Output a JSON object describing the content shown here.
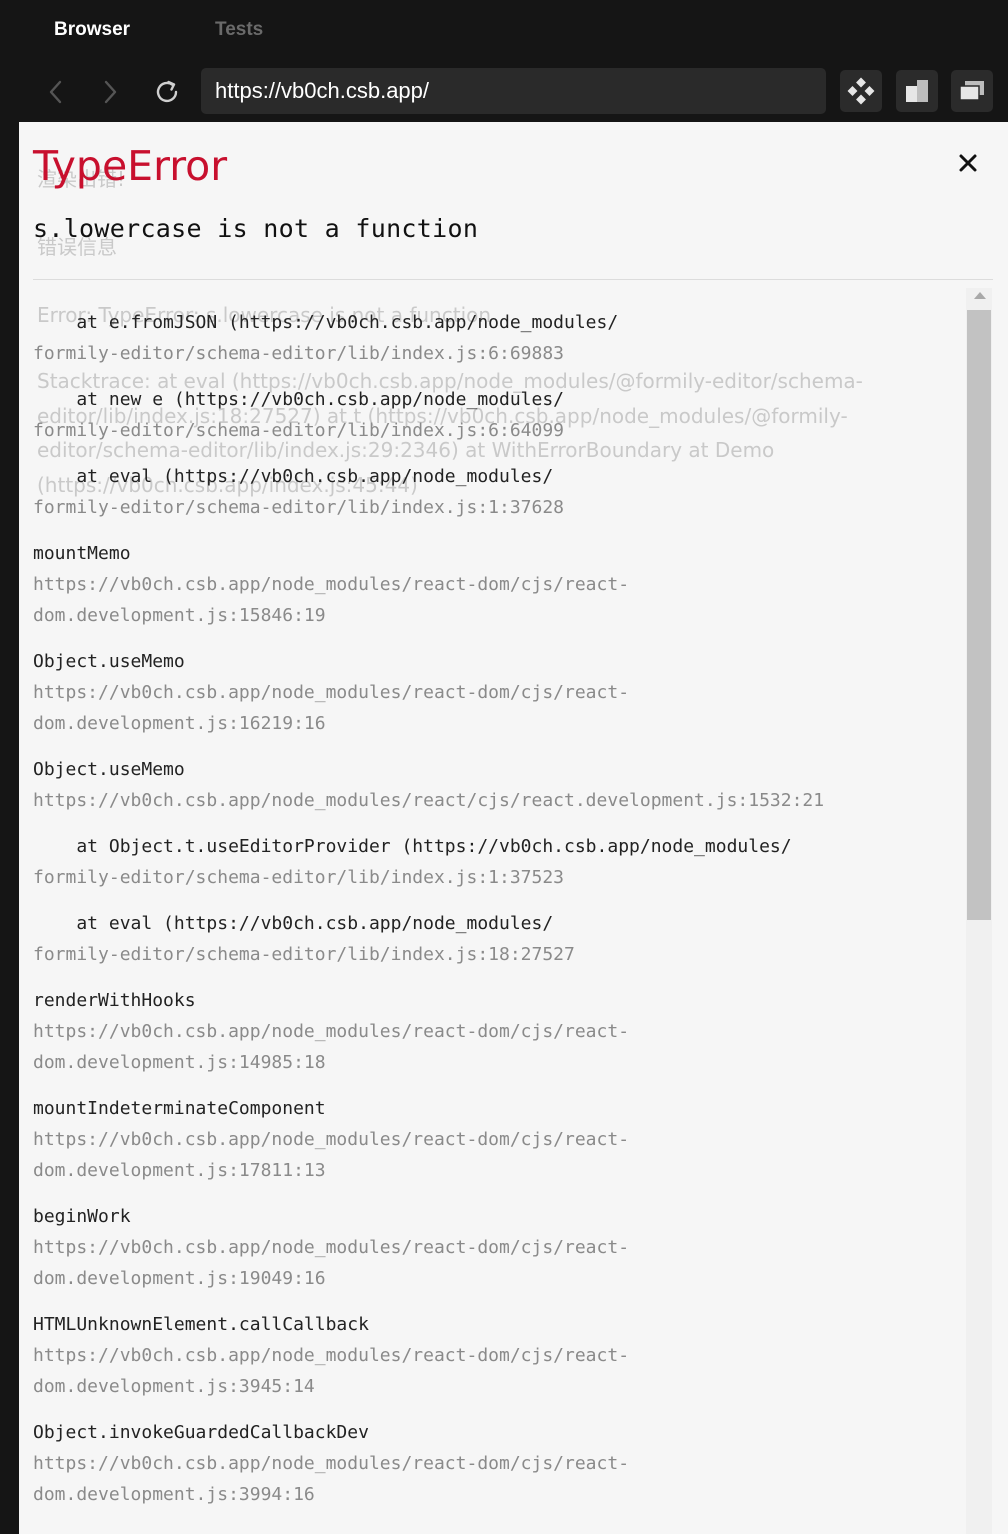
{
  "browser": {
    "tabs": [
      {
        "label": "Browser",
        "active": true
      },
      {
        "label": "Tests",
        "active": false
      }
    ],
    "url": "https://vb0ch.csb.app/",
    "icons": {
      "back": "chevron-left-icon",
      "forward": "chevron-right-icon",
      "refresh": "refresh-icon",
      "devtools": "devtools-icon",
      "split": "split-view-icon",
      "window": "new-window-icon"
    }
  },
  "background_page": {
    "title": "渲染出错!",
    "subtitle": "错误信息",
    "error_line": "Error: TypeError: s.lowercase is not a function",
    "stack_text": "Stacktrace: at eval (https://vb0ch.csb.app/node_modules/@formily-editor/schema-editor/lib/index.js:18:27527) at t (https://vb0ch.csb.app/node_modules/@formily-editor/schema-editor/lib/index.js:29:2346) at WithErrorBoundary at Demo (https://vb0ch.csb.app/index.js:45:44)"
  },
  "overlay": {
    "error_type": "TypeError",
    "message": "s.lowercase is not a function",
    "close_icon": "close-icon",
    "accent_color": "#c8102e",
    "frames": [
      {
        "fn": "    at e.fromJSON (https://vb0ch.csb.app/node_modules/",
        "loc": "formily-editor/schema-editor/lib/index.js:6:69883"
      },
      {
        "fn": "    at new e (https://vb0ch.csb.app/node_modules/",
        "loc": "formily-editor/schema-editor/lib/index.js:6:64099"
      },
      {
        "fn": "    at eval (https://vb0ch.csb.app/node_modules/",
        "loc": "formily-editor/schema-editor/lib/index.js:1:37628"
      },
      {
        "fn": "mountMemo",
        "loc": "https://vb0ch.csb.app/node_modules/react-dom/cjs/react-\ndom.development.js:15846:19"
      },
      {
        "fn": "Object.useMemo",
        "loc": "https://vb0ch.csb.app/node_modules/react-dom/cjs/react-\ndom.development.js:16219:16"
      },
      {
        "fn": "Object.useMemo",
        "loc": "https://vb0ch.csb.app/node_modules/react/cjs/react.development.js:1532:21"
      },
      {
        "fn": "    at Object.t.useEditorProvider (https://vb0ch.csb.app/node_modules/",
        "loc": "formily-editor/schema-editor/lib/index.js:1:37523"
      },
      {
        "fn": "    at eval (https://vb0ch.csb.app/node_modules/",
        "loc": "formily-editor/schema-editor/lib/index.js:18:27527"
      },
      {
        "fn": "renderWithHooks",
        "loc": "https://vb0ch.csb.app/node_modules/react-dom/cjs/react-\ndom.development.js:14985:18"
      },
      {
        "fn": "mountIndeterminateComponent",
        "loc": "https://vb0ch.csb.app/node_modules/react-dom/cjs/react-\ndom.development.js:17811:13"
      },
      {
        "fn": "beginWork",
        "loc": "https://vb0ch.csb.app/node_modules/react-dom/cjs/react-\ndom.development.js:19049:16"
      },
      {
        "fn": "HTMLUnknownElement.callCallback",
        "loc": "https://vb0ch.csb.app/node_modules/react-dom/cjs/react-\ndom.development.js:3945:14"
      },
      {
        "fn": "Object.invokeGuardedCallbackDev",
        "loc": "https://vb0ch.csb.app/node_modules/react-dom/cjs/react-\ndom.development.js:3994:16"
      }
    ]
  }
}
